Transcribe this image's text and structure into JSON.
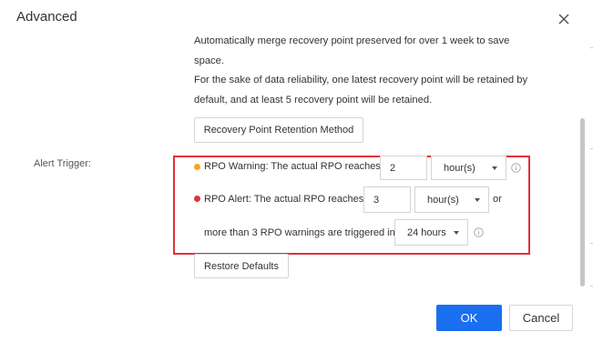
{
  "dialog": {
    "title": "Advanced",
    "close_icon": "close-icon"
  },
  "description": {
    "line1": "Automatically merge recovery point preserved for over 1 week to save",
    "line2": "space.",
    "line3": "For the sake of data reliability, one latest recovery point will be retained by",
    "line4": "default, and at least 5 recovery point will be retained."
  },
  "retention_button": "Recovery Point Retention Method",
  "alert_trigger": {
    "label": "Alert Trigger:",
    "border_color": "#e0313a",
    "warning": {
      "dot_color": "#f5a623",
      "text": "RPO Warning: The actual RPO reaches",
      "value": "2",
      "unit": "hour(s)",
      "info_icon": "info-icon"
    },
    "alert": {
      "dot_color": "#d9363e",
      "text": "RPO Alert: The actual RPO reaches",
      "value": "3",
      "unit": "hour(s)",
      "suffix": "or"
    },
    "count": {
      "text": "more than 3 RPO warnings are triggered in",
      "period": "24 hours",
      "info_icon": "info-icon"
    }
  },
  "restore_button": "Restore Defaults",
  "footer": {
    "ok_label": "OK",
    "cancel_label": "Cancel",
    "ok_color": "#1a6ff0"
  }
}
